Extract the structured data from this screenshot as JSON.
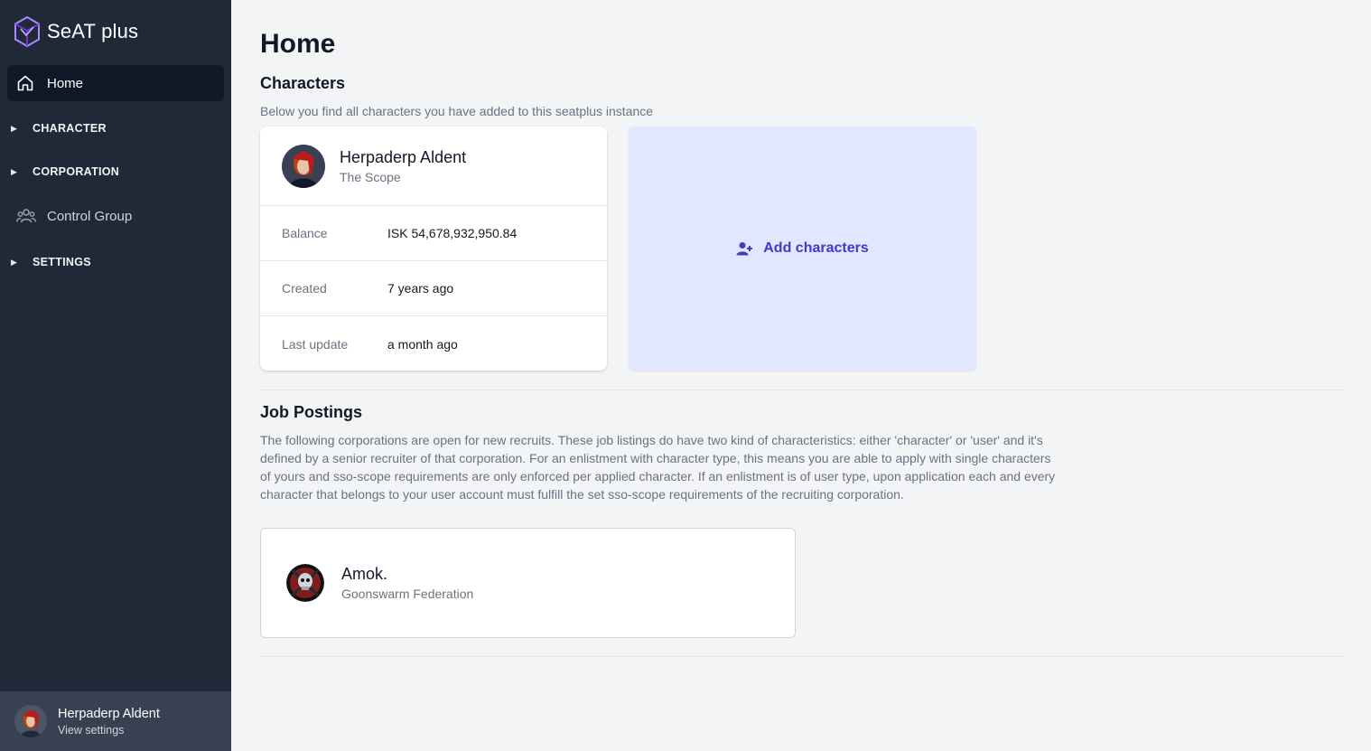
{
  "brand": {
    "name": "SeAT plus",
    "logo_icon": "cube-logo-icon"
  },
  "sidebar": {
    "home": {
      "label": "Home",
      "icon": "home-icon"
    },
    "sections": [
      {
        "label": "CHARACTER"
      },
      {
        "label": "CORPORATION"
      },
      {
        "label": "SETTINGS"
      }
    ],
    "control_group": {
      "label": "Control Group",
      "icon": "users-icon"
    }
  },
  "user": {
    "name": "Herpaderp Aldent",
    "sub": "View settings"
  },
  "page": {
    "title": "Home"
  },
  "characters": {
    "title": "Characters",
    "description": "Below you find all characters you have added to this seatplus instance",
    "card": {
      "name": "Herpaderp Aldent",
      "corporation": "The Scope",
      "rows": [
        {
          "key": "Balance",
          "value": "ISK 54,678,932,950.84"
        },
        {
          "key": "Created",
          "value": "7 years ago"
        },
        {
          "key": "Last update",
          "value": "a month ago"
        }
      ]
    },
    "add_label": "Add characters"
  },
  "jobs": {
    "title": "Job Postings",
    "description": "The following corporations are open for new recruits. These job listings do have two kind of characteristics: either 'character' or 'user' and it's defined by a senior recruiter of that corporation. For an enlistment with character type, this means you are able to apply with single characters of yours and sso-scope requirements are only enforced per applied character. If an enlistment is of user type, upon application each and every character that belongs to your user account must fulfill the set sso-scope requirements of the recruiting corporation.",
    "card": {
      "name": "Amok.",
      "alliance": "Goonswarm Federation"
    }
  },
  "colors": {
    "sidebar": "#1f2937",
    "accent": "#4338ca",
    "add_bg": "#e0e7ff"
  }
}
